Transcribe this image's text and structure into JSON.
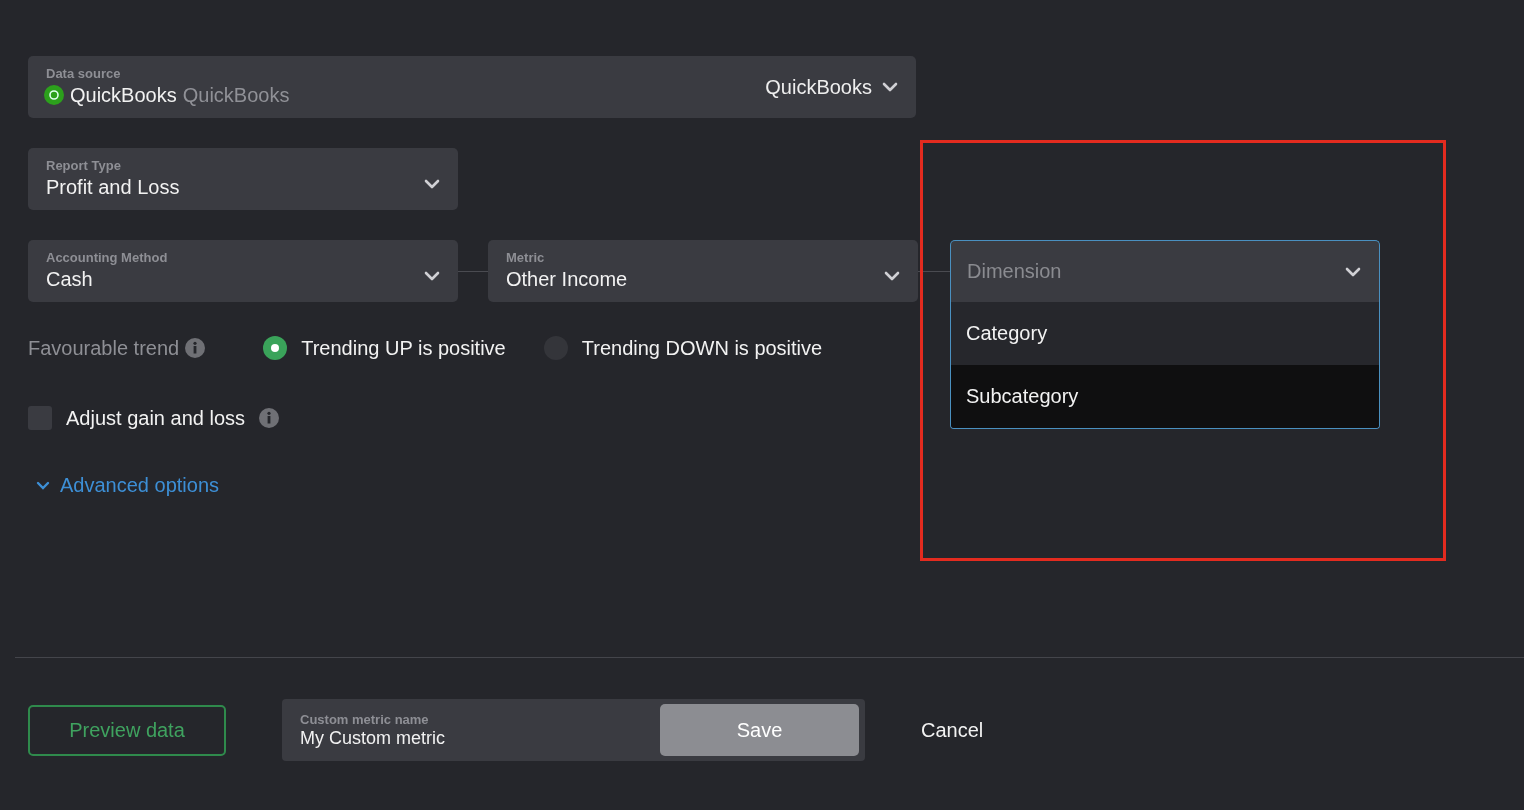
{
  "data_source": {
    "label": "Data source",
    "value": "QuickBooks",
    "secondary": "QuickBooks",
    "selector": "QuickBooks"
  },
  "report_type": {
    "label": "Report Type",
    "value": "Profit and Loss"
  },
  "accounting_method": {
    "label": "Accounting Method",
    "value": "Cash"
  },
  "metric": {
    "label": "Metric",
    "value": "Other Income"
  },
  "dimension": {
    "placeholder": "Dimension",
    "expanded": true,
    "options": [
      {
        "label": "Category",
        "selected": false
      },
      {
        "label": "Subcategory",
        "selected": true
      }
    ]
  },
  "favourable_trend": {
    "label": "Favourable trend",
    "options": [
      {
        "label": "Trending UP is positive",
        "selected": true
      },
      {
        "label": "Trending DOWN is positive",
        "selected": false
      }
    ]
  },
  "adjust_gain_and_loss": {
    "label": "Adjust gain and loss",
    "checked": false
  },
  "advanced_options": {
    "label": "Advanced options",
    "expanded": false
  },
  "footer": {
    "preview_button": "Preview data",
    "name_field": {
      "label": "Custom metric name",
      "value": "My Custom metric"
    },
    "save_button": "Save",
    "cancel_button": "Cancel"
  }
}
